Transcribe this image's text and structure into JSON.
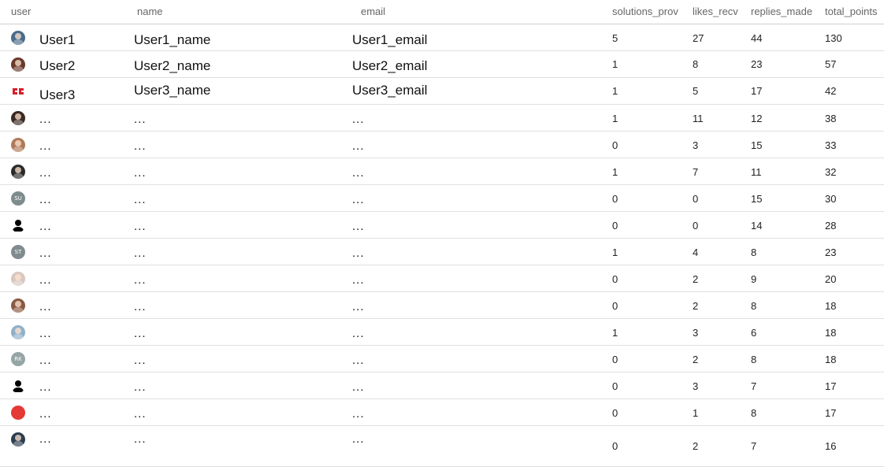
{
  "columns": {
    "user": "user",
    "name": "name",
    "email": "email",
    "solutions": "solutions_prov",
    "likes": "likes_recv",
    "replies": "replies_made",
    "total": "total_points"
  },
  "rows": [
    {
      "user": "User1",
      "name": "User1_name",
      "email": "User1_email",
      "solutions": "5",
      "likes": "27",
      "replies": "44",
      "total": "130",
      "avatar": {
        "icon": "avatar-photo-icon",
        "color": "#4a6b8a",
        "initials": ""
      }
    },
    {
      "user": "User2",
      "name": "User2_name",
      "email": "User2_email",
      "solutions": "1",
      "likes": "8",
      "replies": "23",
      "total": "57",
      "avatar": {
        "icon": "avatar-photo-icon",
        "color": "#6b3a2c",
        "initials": ""
      }
    },
    {
      "user": "User3",
      "name": "User3_name",
      "email": "User3_email",
      "solutions": "1",
      "likes": "5",
      "replies": "17",
      "total": "42",
      "avatar": {
        "icon": "logo-icon",
        "color": "#ffffff",
        "initials": ""
      }
    },
    {
      "user": "...",
      "name": "...",
      "email": "...",
      "solutions": "1",
      "likes": "11",
      "replies": "12",
      "total": "38",
      "avatar": {
        "icon": "avatar-photo-icon",
        "color": "#3a2a22",
        "initials": ""
      }
    },
    {
      "user": "...",
      "name": "...",
      "email": "...",
      "solutions": "0",
      "likes": "3",
      "replies": "15",
      "total": "33",
      "avatar": {
        "icon": "avatar-photo-icon",
        "color": "#b07a5a",
        "initials": ""
      }
    },
    {
      "user": "...",
      "name": "...",
      "email": "...",
      "solutions": "1",
      "likes": "7",
      "replies": "11",
      "total": "32",
      "avatar": {
        "icon": "avatar-photo-icon",
        "color": "#2a2a2a",
        "initials": ""
      }
    },
    {
      "user": "...",
      "name": "...",
      "email": "...",
      "solutions": "0",
      "likes": "0",
      "replies": "15",
      "total": "30",
      "avatar": {
        "icon": "avatar-initials-icon",
        "color": "#7f8c8d",
        "initials": "SU"
      }
    },
    {
      "user": "...",
      "name": "...",
      "email": "...",
      "solutions": "0",
      "likes": "0",
      "replies": "14",
      "total": "28",
      "avatar": {
        "icon": "person-silhouette-icon",
        "color": "#000000",
        "initials": ""
      }
    },
    {
      "user": "...",
      "name": "...",
      "email": "...",
      "solutions": "1",
      "likes": "4",
      "replies": "8",
      "total": "23",
      "avatar": {
        "icon": "avatar-initials-icon",
        "color": "#7f8c8d",
        "initials": "ST"
      }
    },
    {
      "user": "...",
      "name": "...",
      "email": "...",
      "solutions": "0",
      "likes": "2",
      "replies": "9",
      "total": "20",
      "avatar": {
        "icon": "avatar-photo-icon",
        "color": "#d8c8c0",
        "initials": ""
      }
    },
    {
      "user": "...",
      "name": "...",
      "email": "...",
      "solutions": "0",
      "likes": "2",
      "replies": "8",
      "total": "18",
      "avatar": {
        "icon": "avatar-photo-icon",
        "color": "#8a5a44",
        "initials": ""
      }
    },
    {
      "user": "...",
      "name": "...",
      "email": "...",
      "solutions": "1",
      "likes": "3",
      "replies": "6",
      "total": "18",
      "avatar": {
        "icon": "avatar-photo-icon",
        "color": "#8fb0c8",
        "initials": ""
      }
    },
    {
      "user": "...",
      "name": "...",
      "email": "...",
      "solutions": "0",
      "likes": "2",
      "replies": "8",
      "total": "18",
      "avatar": {
        "icon": "avatar-initials-icon",
        "color": "#95a5a6",
        "initials": "RK"
      }
    },
    {
      "user": "...",
      "name": "...",
      "email": "...",
      "solutions": "0",
      "likes": "3",
      "replies": "7",
      "total": "17",
      "avatar": {
        "icon": "person-silhouette-icon",
        "color": "#000000",
        "initials": ""
      }
    },
    {
      "user": "...",
      "name": "...",
      "email": "...",
      "solutions": "0",
      "likes": "1",
      "replies": "8",
      "total": "17",
      "avatar": {
        "icon": "avatar-badge-icon",
        "color": "#e53935",
        "initials": ""
      }
    },
    {
      "user": "...",
      "name": "...",
      "email": "...",
      "solutions": "0",
      "likes": "2",
      "replies": "7",
      "total": "16",
      "avatar": {
        "icon": "avatar-photo-icon",
        "color": "#2c3e50",
        "initials": ""
      }
    }
  ]
}
